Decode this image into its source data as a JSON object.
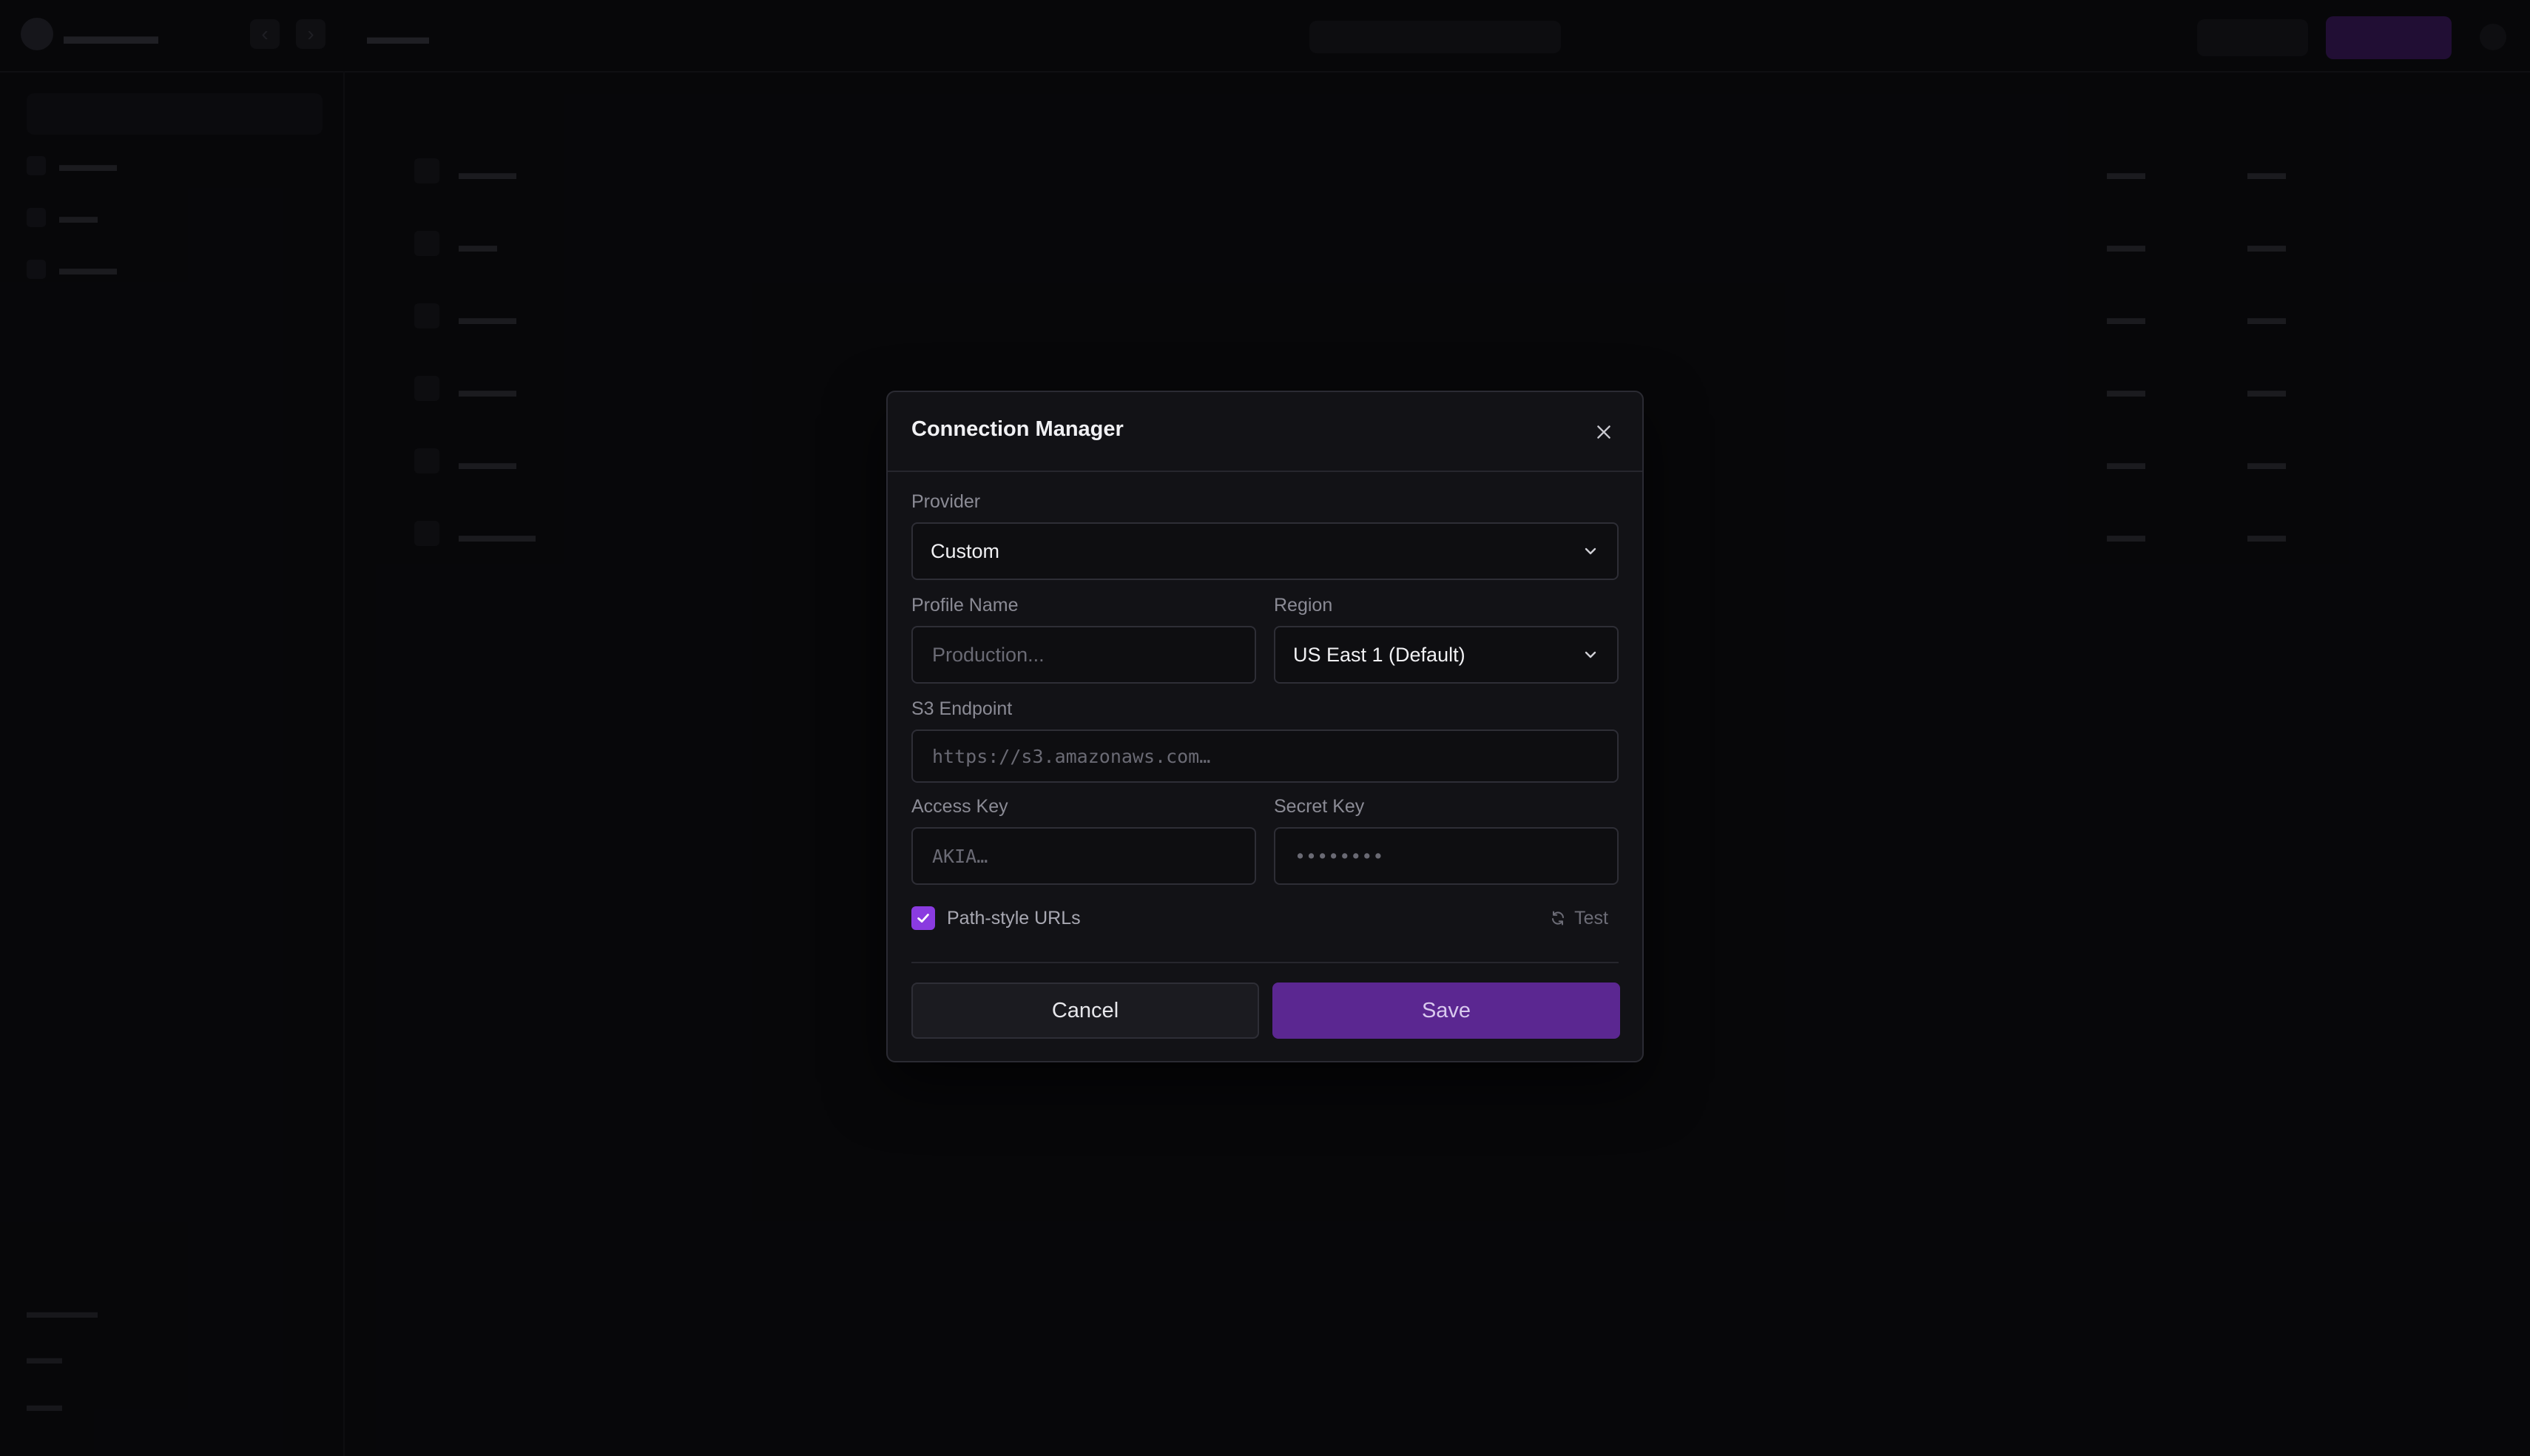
{
  "modal": {
    "title": "Connection Manager",
    "provider": {
      "label": "Provider",
      "value": "Custom"
    },
    "profile_name": {
      "label": "Profile Name",
      "placeholder": "Production..."
    },
    "region": {
      "label": "Region",
      "value": "US East 1 (Default)"
    },
    "s3_endpoint": {
      "label": "S3 Endpoint",
      "placeholder": "https://s3.amazonaws.com…"
    },
    "access_key": {
      "label": "Access Key",
      "placeholder": "AKIA…"
    },
    "secret_key": {
      "label": "Secret Key",
      "placeholder": "••••••••"
    },
    "path_style": {
      "label": "Path-style URLs",
      "checked": true
    },
    "test_label": "Test",
    "cancel_label": "Cancel",
    "save_label": "Save"
  },
  "colors": {
    "accent": "#8a3be0",
    "save_button": "#5b2791",
    "background": "#0a0a0d",
    "modal_bg": "#121216"
  },
  "icons": {
    "close": "close-icon",
    "chevron": "chevron-down-icon",
    "check": "check-icon",
    "refresh": "refresh-icon"
  }
}
